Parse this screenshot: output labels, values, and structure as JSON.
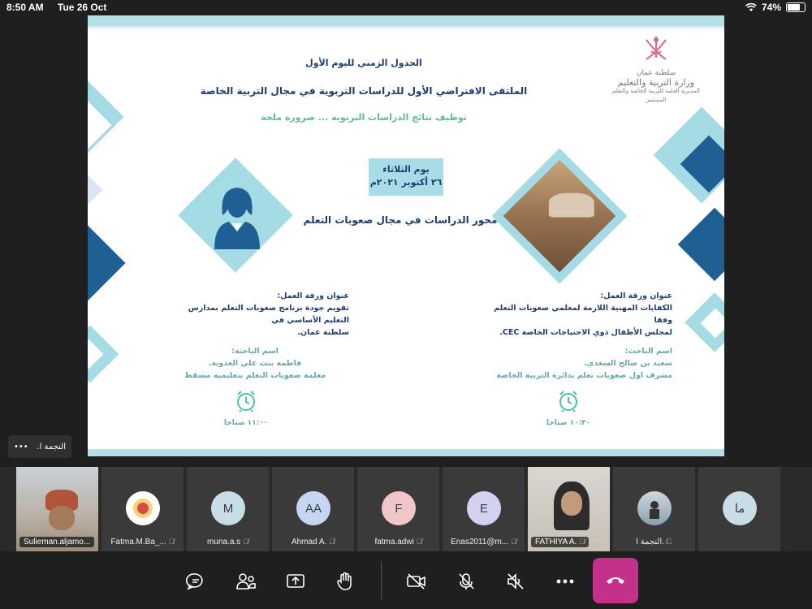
{
  "status_bar": {
    "time": "8:50 AM",
    "date": "Tue 26 Oct",
    "battery": "74%",
    "battery_level": 0.74
  },
  "slide": {
    "ministry_logo_text": [
      "سلطنة عمان",
      "وزارة التربية والتعليم",
      "المديرية العامة للتربية الخاصة والتعلم المستمر"
    ],
    "title_line1": "الجدول الزمني لليوم الأول",
    "title_line2": "الملتقى الافتراضي الأول للدراسات التربوية في مجال التربية الخاصة",
    "title_line3": "توظيف نتائج الدراسات التربوية ... ضرورة ملحة",
    "day": "يوم الثلاثاء",
    "date": "٢٦ أكتوبر ٢٠٢١م",
    "axis_title": "محور الدراسات في مجال صعوبات التعلم",
    "right_paper": {
      "label": "عنوان ورقة العمل:",
      "title_l1": "الكفايات المهنية اللازمة لمعلمي صعوبات التعلم وفقا",
      "title_l2": "لمجلس الأطفال ذوي الاحتياجات الخاصة CEC.",
      "researcher_label": "اسم الباحث:",
      "researcher": "سعيد بن صالح السعدي.",
      "role": "مشرف اول صعوبات تعلم بدائرة التربية الخاصة",
      "time": "١٠:٣٠ صباحا"
    },
    "left_paper": {
      "label": "عنوان ورقة العمل:",
      "title_l1": "تقويم جودة برنامج صعوبات التعلم بمدارس التعليم الأساسي في",
      "title_l2": "سلطنة عمان.",
      "researcher_label": "اسم الباحثة:",
      "researcher": "فاطمة بنت علي العدوية.",
      "role": "معلمة صعوبات التعلم بتعليمية مسقط",
      "time": "١١:٠٠ صباحا"
    }
  },
  "self_view": {
    "name": "النجمة ا.",
    "more": "•••"
  },
  "participants": [
    {
      "name": "Sulieman.aljamo...",
      "type": "video"
    },
    {
      "name": "Fatma.M.Ba_...",
      "type": "logo",
      "muted": true
    },
    {
      "name": "muna.a.s",
      "initials": "M",
      "color": "#c8dde6",
      "muted": true
    },
    {
      "name": "Ahmad A.",
      "initials": "AA",
      "color": "#c6d6f2",
      "muted": true
    },
    {
      "name": "fatma.adwi",
      "initials": "F",
      "color": "#f2c6c8",
      "muted": true
    },
    {
      "name": "Enas2011@m...",
      "initials": "E",
      "color": "#d2d2f0",
      "muted": true
    },
    {
      "name": "FATHIYA A.",
      "type": "video",
      "muted": true
    },
    {
      "name": "النجمة ا.",
      "type": "photo",
      "muted": true
    },
    {
      "name": "",
      "initials": "ما",
      "color": "#c8dde6"
    }
  ],
  "toolbar": {
    "icons": [
      "chat-icon",
      "people-icon",
      "share-icon",
      "raise-hand-icon",
      "camera-off-icon",
      "mic-off-icon",
      "speaker-off-icon",
      "more-icon",
      "hang-up-icon"
    ],
    "hangup_color": "#c4318a"
  }
}
